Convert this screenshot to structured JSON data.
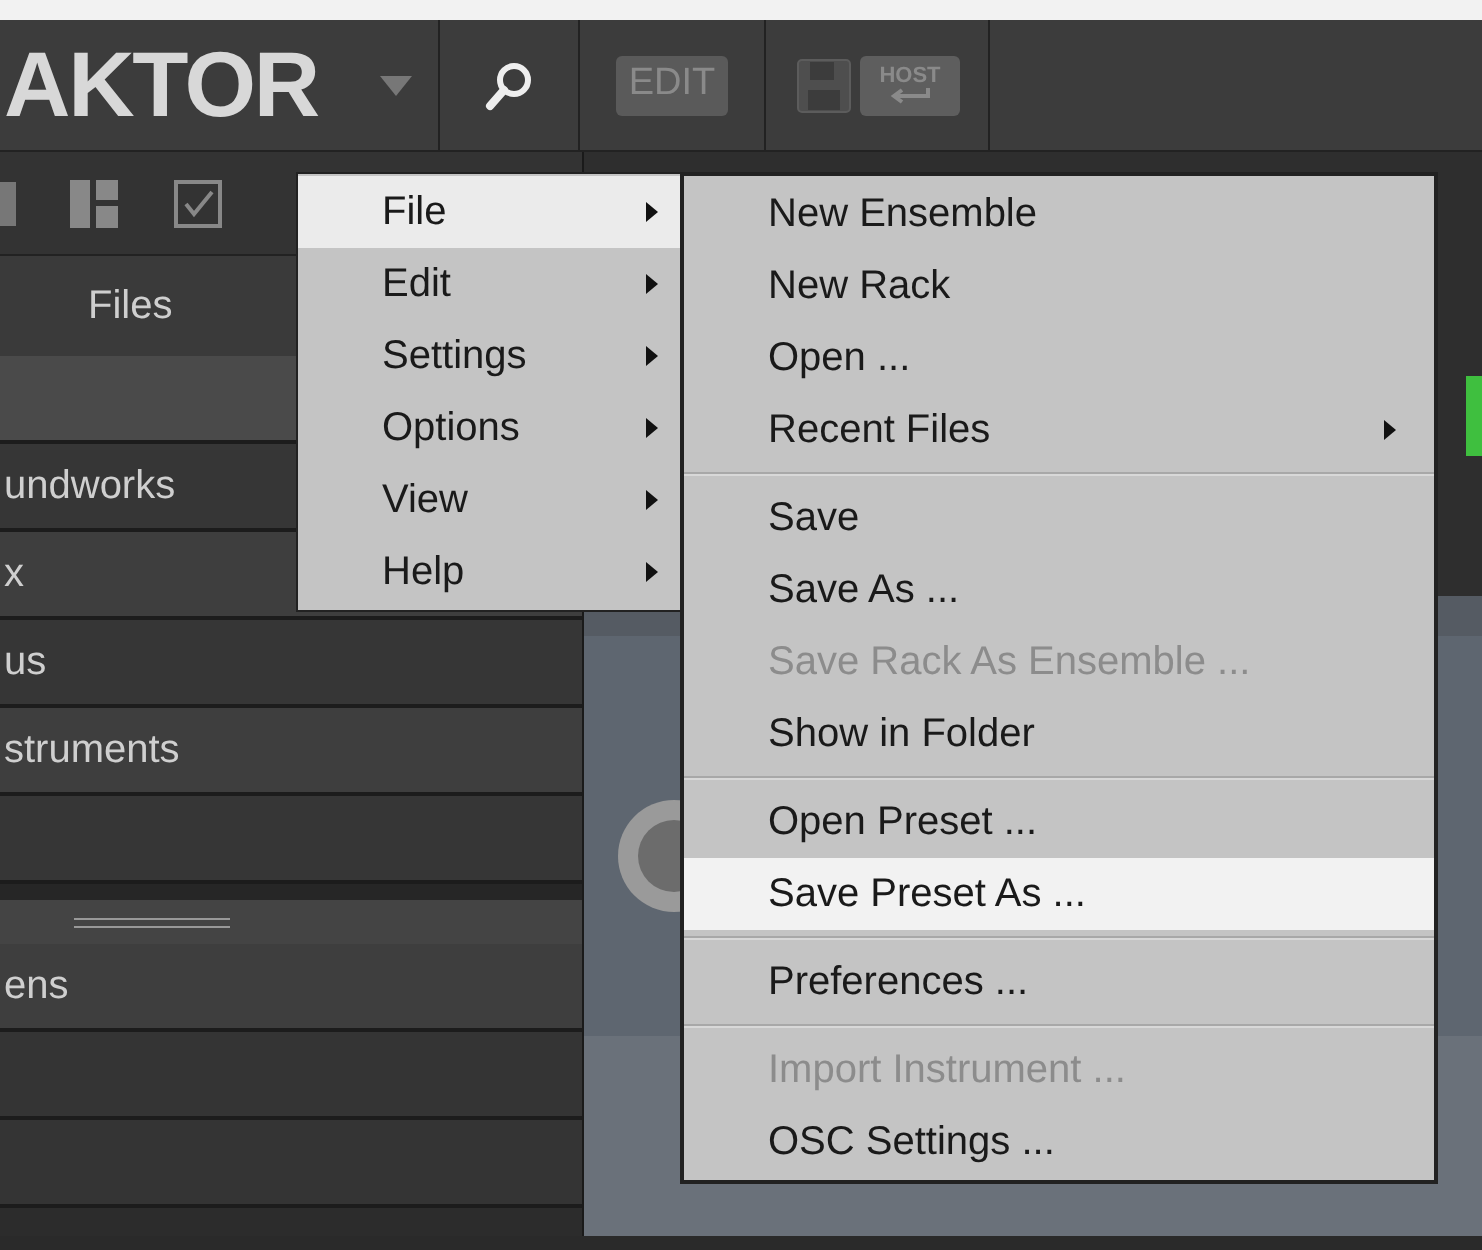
{
  "header": {
    "logo": "AKTOR",
    "edit_button": "EDIT",
    "host_button": "HOST"
  },
  "sidebar": {
    "tab": "Files",
    "rows": [
      {
        "label": "undworks"
      },
      {
        "label": "x"
      },
      {
        "label": "us"
      },
      {
        "label": "struments"
      }
    ],
    "rows_below": [
      {
        "label": "ens"
      }
    ]
  },
  "menu": {
    "items": [
      {
        "label": "File",
        "selected": true,
        "has_submenu": true
      },
      {
        "label": "Edit",
        "selected": false,
        "has_submenu": true
      },
      {
        "label": "Settings",
        "selected": false,
        "has_submenu": true
      },
      {
        "label": "Options",
        "selected": false,
        "has_submenu": true
      },
      {
        "label": "View",
        "selected": false,
        "has_submenu": true
      },
      {
        "label": "Help",
        "selected": false,
        "has_submenu": true
      }
    ]
  },
  "submenu": {
    "items": [
      {
        "kind": "item",
        "label": "New Ensemble",
        "selected": false,
        "disabled": false,
        "has_submenu": false
      },
      {
        "kind": "item",
        "label": "New Rack",
        "selected": false,
        "disabled": false,
        "has_submenu": false
      },
      {
        "kind": "item",
        "label": "Open ...",
        "selected": false,
        "disabled": false,
        "has_submenu": false
      },
      {
        "kind": "item",
        "label": "Recent Files",
        "selected": false,
        "disabled": false,
        "has_submenu": true
      },
      {
        "kind": "separator"
      },
      {
        "kind": "item",
        "label": "Save",
        "selected": false,
        "disabled": false,
        "has_submenu": false
      },
      {
        "kind": "item",
        "label": "Save As ...",
        "selected": false,
        "disabled": false,
        "has_submenu": false
      },
      {
        "kind": "item",
        "label": "Save Rack As Ensemble ...",
        "selected": false,
        "disabled": true,
        "has_submenu": false
      },
      {
        "kind": "item",
        "label": "Show in Folder",
        "selected": false,
        "disabled": false,
        "has_submenu": false
      },
      {
        "kind": "separator"
      },
      {
        "kind": "item",
        "label": "Open Preset ...",
        "selected": false,
        "disabled": false,
        "has_submenu": false
      },
      {
        "kind": "item",
        "label": "Save Preset As ...",
        "selected": true,
        "disabled": false,
        "has_submenu": false
      },
      {
        "kind": "separator"
      },
      {
        "kind": "item",
        "label": "Preferences ...",
        "selected": false,
        "disabled": false,
        "has_submenu": false
      },
      {
        "kind": "separator"
      },
      {
        "kind": "item",
        "label": "Import Instrument ...",
        "selected": false,
        "disabled": true,
        "has_submenu": false
      },
      {
        "kind": "item",
        "label": "OSC Settings ...",
        "selected": false,
        "disabled": false,
        "has_submenu": false
      }
    ]
  }
}
